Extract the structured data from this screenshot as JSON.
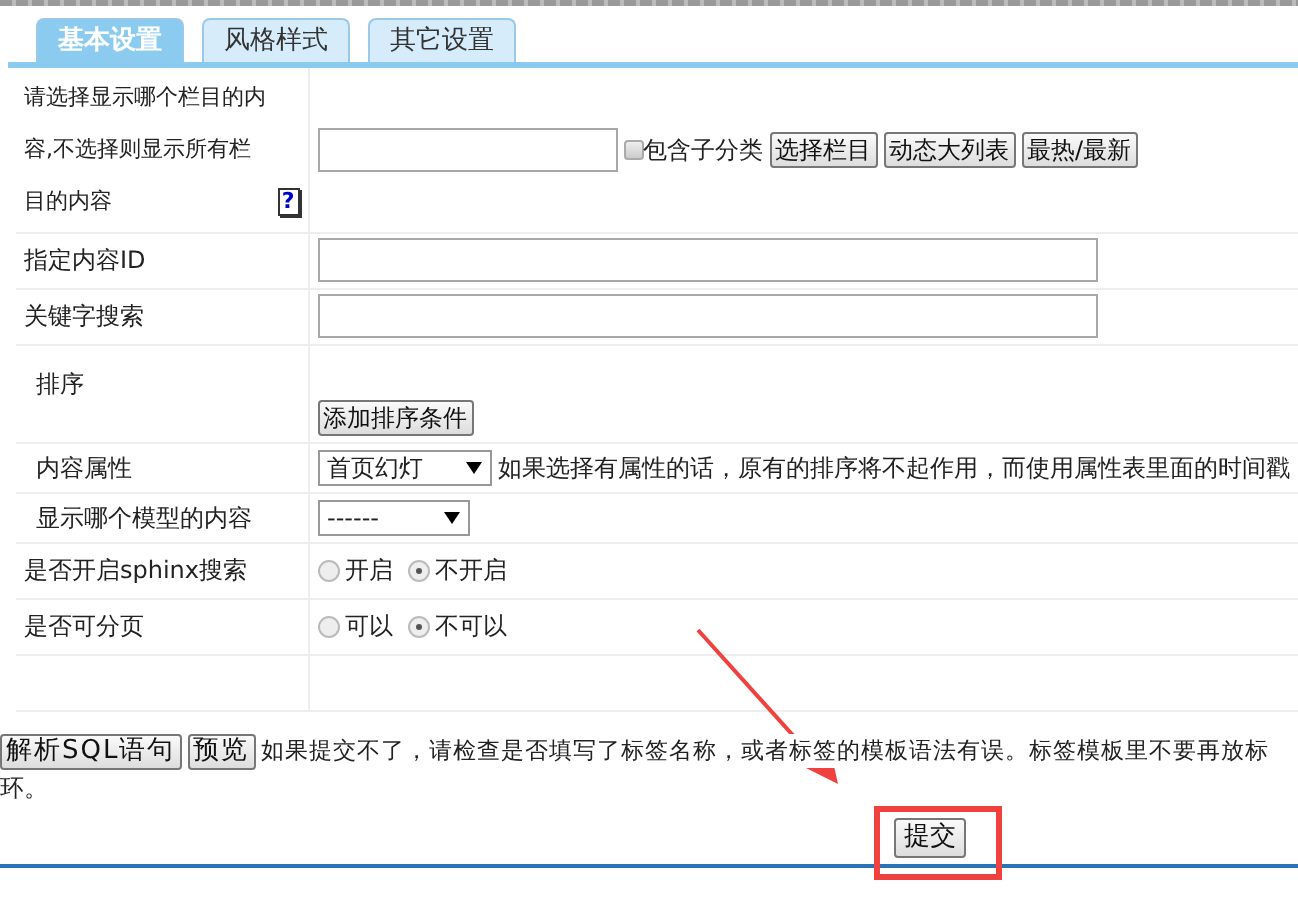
{
  "tabs": [
    {
      "label": "基本设置",
      "selected": true
    },
    {
      "label": "风格样式",
      "selected": false
    },
    {
      "label": "其它设置",
      "selected": false
    }
  ],
  "rows": [
    {
      "kind": "category",
      "label": "请选择显示哪个栏目的内容,不选择则显示所有栏目的内容",
      "help": "?",
      "checkbox": {
        "label": "包含子分类",
        "checked": false
      },
      "buttons": [
        "选择栏目",
        "动态大列表",
        "最热/最新"
      ]
    },
    {
      "kind": "text",
      "label": "指定内容ID"
    },
    {
      "kind": "text",
      "label": "关键字搜索"
    },
    {
      "kind": "sort",
      "label": "排序",
      "button": "添加排序条件"
    },
    {
      "kind": "select",
      "label": "内容属性",
      "value": "首页幻灯",
      "note": "如果选择有属性的话，原有的排序将不起作用，而使用属性表里面的时间戳"
    },
    {
      "kind": "select",
      "label": "显示哪个模型的内容",
      "value": "------"
    },
    {
      "kind": "radio",
      "label": "是否开启sphinx搜索",
      "options": [
        {
          "label": "开启",
          "selected": false
        },
        {
          "label": "不开启",
          "selected": true
        }
      ]
    },
    {
      "kind": "radio",
      "label": "是否可分页",
      "options": [
        {
          "label": "可以",
          "selected": false
        },
        {
          "label": "不可以",
          "selected": true
        }
      ]
    },
    {
      "kind": "empty"
    }
  ],
  "footer": {
    "buttons": [
      "解析SQL语句",
      "预览"
    ],
    "note_lines": [
      "如果提交不了，请检查是否填写了标签名称，或者标签的模板语法有误。标签模板里不要再放标",
      "环。"
    ],
    "submit": "提交"
  },
  "annotations": {
    "arrow": true,
    "highlight_box": true
  }
}
